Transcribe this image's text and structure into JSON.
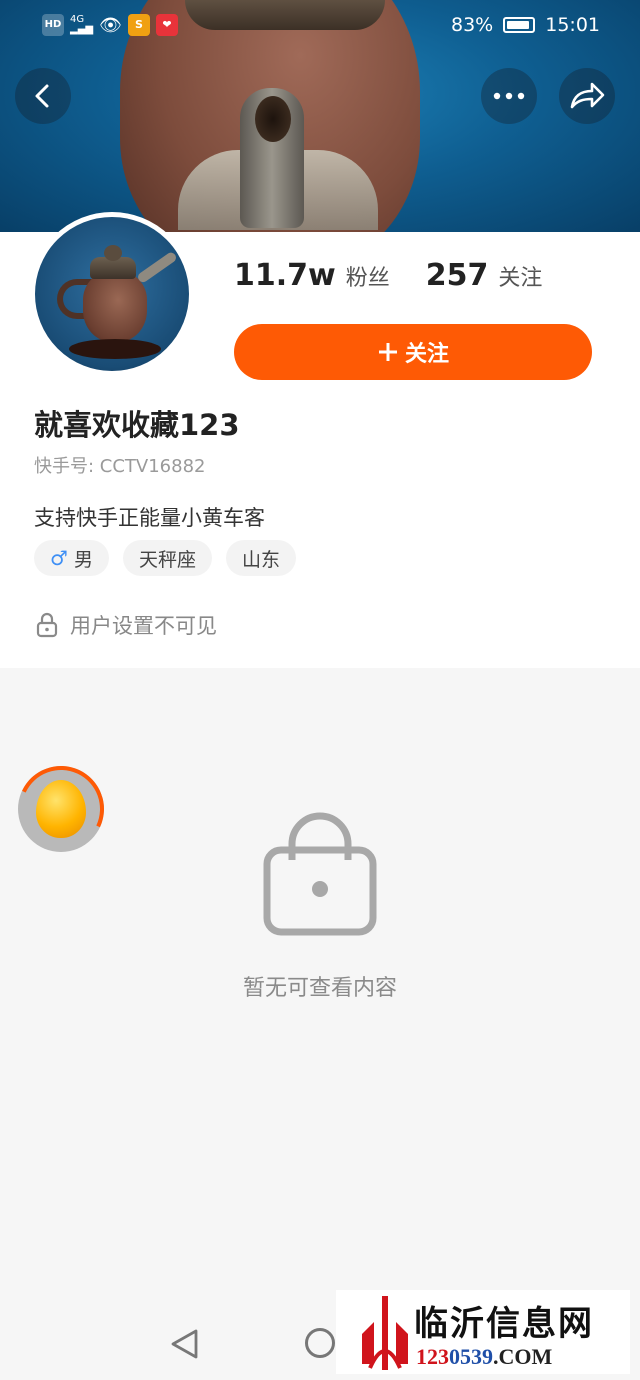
{
  "status_bar": {
    "left_icons": [
      "HD",
      "4G",
      "signal-bars",
      "eye-icon",
      "app-badge-1",
      "app-badge-2"
    ],
    "battery": "83%",
    "time": "15:01"
  },
  "header": {
    "back_icon": "chevron-left-icon",
    "more_icon": "more-dots-icon",
    "share_icon": "share-arrow-icon"
  },
  "profile": {
    "followers_count": "11.7w",
    "followers_label": "粉丝",
    "following_count": "257",
    "following_label": "关注",
    "follow_button": "关注",
    "username": "就喜欢收藏123",
    "user_id": "快手号: CCTV16882",
    "bio": "支持快手正能量小黄车客",
    "tags": {
      "gender_symbol": "♂",
      "gender": "男",
      "zodiac": "天秤座",
      "location": "山东"
    },
    "privacy_text": "用户设置不可见"
  },
  "content": {
    "empty_text": "暂无可查看内容"
  },
  "watermark": {
    "title": "临沂信息网",
    "url_part1": "123",
    "url_part2": "0539",
    "url_part3": ".COM"
  },
  "colors": {
    "accent": "#fe5a05",
    "gender_blue": "#3e8ff5",
    "banner_blue": "#0f5f92"
  }
}
